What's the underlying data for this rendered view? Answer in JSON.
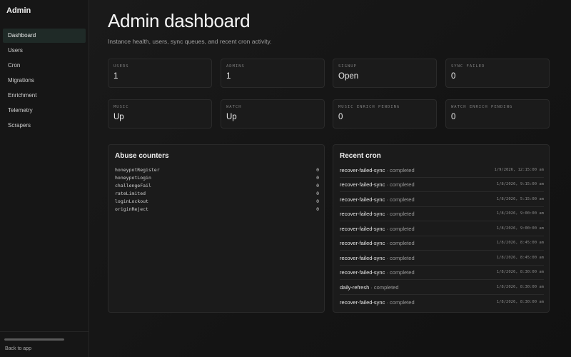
{
  "sidebar": {
    "brand": "Admin",
    "items": [
      {
        "label": "Dashboard"
      },
      {
        "label": "Users"
      },
      {
        "label": "Cron"
      },
      {
        "label": "Migrations"
      },
      {
        "label": "Enrichment"
      },
      {
        "label": "Telemetry"
      },
      {
        "label": "Scrapers"
      }
    ],
    "active_index": 0,
    "back_label": "Back to app"
  },
  "header": {
    "title": "Admin dashboard",
    "subtitle": "Instance health, users, sync queues, and recent cron activity."
  },
  "stats": [
    {
      "label": "USERS",
      "value": "1"
    },
    {
      "label": "ADMINS",
      "value": "1"
    },
    {
      "label": "SIGNUP",
      "value": "Open"
    },
    {
      "label": "SYNC FAILED",
      "value": "0"
    },
    {
      "label": "MUSIC",
      "value": "Up"
    },
    {
      "label": "WATCH",
      "value": "Up"
    },
    {
      "label": "MUSIC ENRICH PENDING",
      "value": "0"
    },
    {
      "label": "WATCH ENRICH PENDING",
      "value": "0"
    }
  ],
  "abuse": {
    "title": "Abuse counters",
    "rows": [
      {
        "name": "honeypotRegister",
        "value": "0"
      },
      {
        "name": "honeypotLogin",
        "value": "0"
      },
      {
        "name": "challengeFail",
        "value": "0"
      },
      {
        "name": "rateLimited",
        "value": "0"
      },
      {
        "name": "loginLockout",
        "value": "0"
      },
      {
        "name": "originReject",
        "value": "0"
      }
    ]
  },
  "cron": {
    "title": "Recent cron",
    "rows": [
      {
        "job": "recover-failed-sync",
        "status": " · completed",
        "time": "1/9/2026, 12:15:00 am"
      },
      {
        "job": "recover-failed-sync",
        "status": " · completed",
        "time": "1/8/2026, 9:15:00 am"
      },
      {
        "job": "recover-failed-sync",
        "status": " · completed",
        "time": "1/8/2026, 5:15:00 am"
      },
      {
        "job": "recover-failed-sync",
        "status": " · completed",
        "time": "1/8/2026, 9:00:00 am"
      },
      {
        "job": "recover-failed-sync",
        "status": " · completed",
        "time": "1/8/2026, 9:00:00 am"
      },
      {
        "job": "recover-failed-sync",
        "status": " · completed",
        "time": "1/8/2026, 8:45:00 am"
      },
      {
        "job": "recover-failed-sync",
        "status": " · completed",
        "time": "1/8/2026, 8:45:00 am"
      },
      {
        "job": "recover-failed-sync",
        "status": " · completed",
        "time": "1/8/2026, 8:30:00 am"
      },
      {
        "job": "daily-refresh",
        "status": " · completed",
        "time": "1/8/2026, 8:30:00 am"
      },
      {
        "job": "recover-failed-sync",
        "status": " · completed",
        "time": "1/8/2026, 8:30:00 am"
      }
    ]
  }
}
